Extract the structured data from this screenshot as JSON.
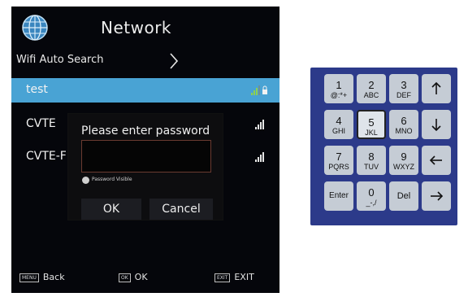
{
  "tv": {
    "title": "Network",
    "wifi_auto_search": "Wifi Auto Search",
    "networks": [
      {
        "name": "test",
        "selected": true,
        "signal": "lock-signal"
      },
      {
        "name": "CVTE",
        "selected": false,
        "signal": "signal"
      },
      {
        "name": "CVTE-F",
        "selected": false,
        "signal": "signal"
      }
    ],
    "dialog": {
      "title": "Please enter password",
      "password_value": "",
      "password_visible_label": "Password Visible",
      "ok_label": "OK",
      "cancel_label": "Cancel"
    },
    "footer": {
      "menu_key": "MENU",
      "menu_label": "Back",
      "ok_key": "OK",
      "ok_label": "OK",
      "exit_key": "EXIT",
      "exit_label": "EXIT"
    },
    "colors": {
      "selected_row": "#49a3d4",
      "background": "#05060b"
    }
  },
  "keypad": {
    "keys": [
      {
        "num": "1",
        "letters": "@:*+"
      },
      {
        "num": "2",
        "letters": "ABC"
      },
      {
        "num": "3",
        "letters": "DEF"
      },
      {
        "num": "4",
        "letters": "GHI"
      },
      {
        "num": "5",
        "letters": "JKL"
      },
      {
        "num": "6",
        "letters": "MNO"
      },
      {
        "num": "7",
        "letters": "PQRS"
      },
      {
        "num": "8",
        "letters": "TUV"
      },
      {
        "num": "9",
        "letters": "WXYZ"
      },
      {
        "num": "0",
        "letters": "_-,/"
      }
    ],
    "enter_label": "Enter",
    "del_label": "Del",
    "color": "#2c3a8a"
  }
}
